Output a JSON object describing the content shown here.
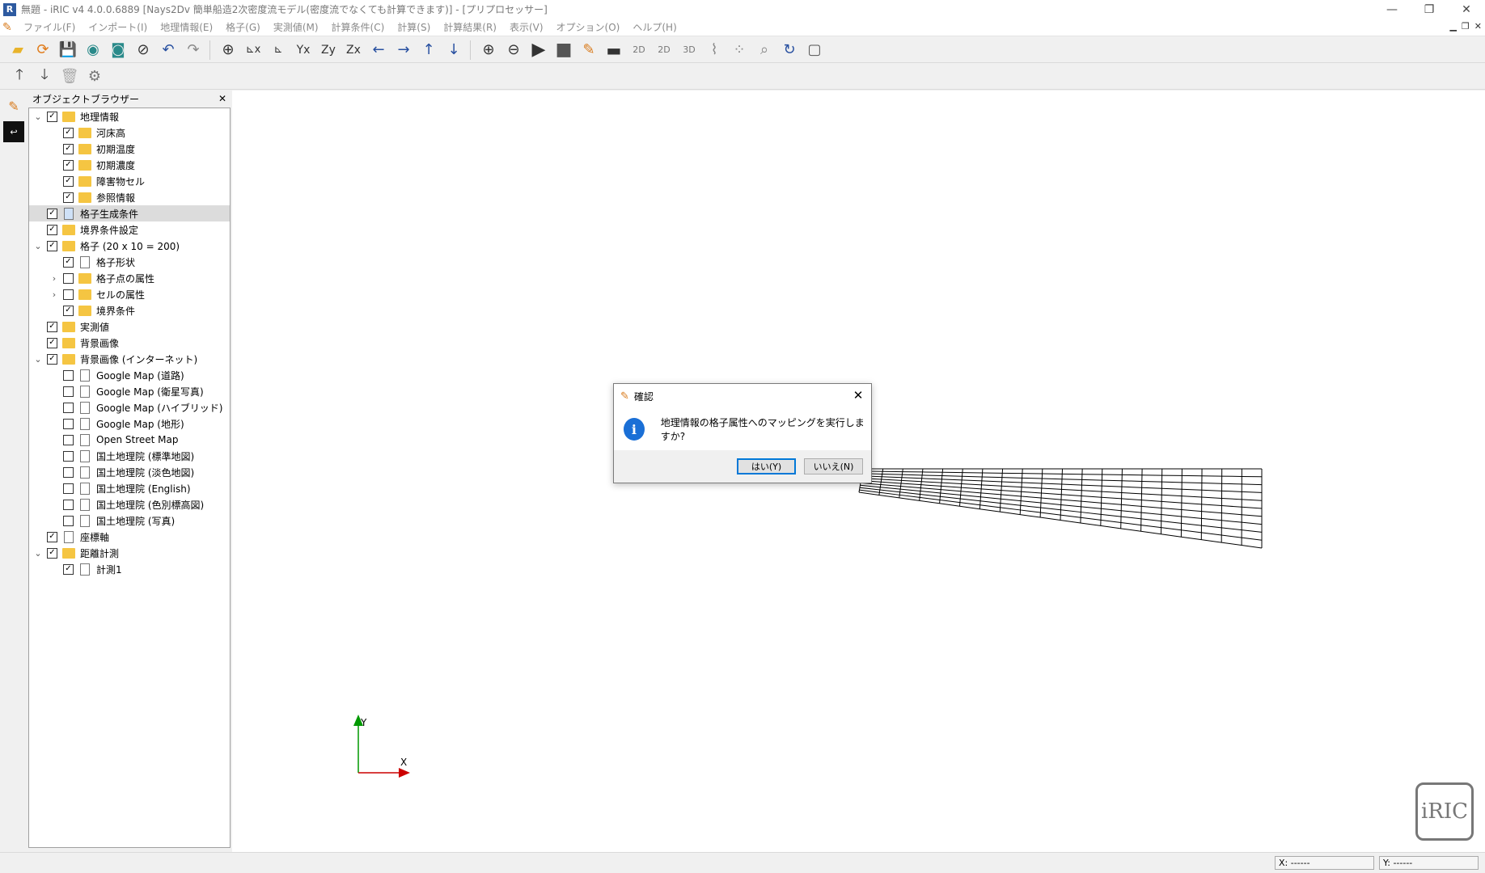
{
  "window": {
    "title": "無題 - iRIC v4 4.0.0.6889 [Nays2Dv 簡単船造2次密度流モデル(密度流でなくても計算できます)] - [プリプロセッサー]",
    "minimize": "—",
    "restore": "❐",
    "close": "✕"
  },
  "menu": {
    "items": [
      "ファイル(F)",
      "インポート(I)",
      "地理情報(E)",
      "格子(G)",
      "実測値(M)",
      "計算条件(C)",
      "計算(S)",
      "計算結果(R)",
      "表示(V)",
      "オプション(O)",
      "ヘルプ(H)"
    ]
  },
  "object_browser": {
    "title": "オブジェクトブラウザー",
    "close": "✕",
    "tree": [
      {
        "level": 0,
        "expander": "v",
        "checked": true,
        "icon": "folder",
        "label": "地理情報"
      },
      {
        "level": 1,
        "expander": "",
        "checked": true,
        "icon": "folder",
        "label": "河床高"
      },
      {
        "level": 1,
        "expander": "",
        "checked": true,
        "icon": "folder",
        "label": "初期温度"
      },
      {
        "level": 1,
        "expander": "",
        "checked": true,
        "icon": "folder",
        "label": "初期濃度"
      },
      {
        "level": 1,
        "expander": "",
        "checked": true,
        "icon": "folder",
        "label": "障害物セル"
      },
      {
        "level": 1,
        "expander": "",
        "checked": true,
        "icon": "folder",
        "label": "参照情報"
      },
      {
        "level": 0,
        "expander": "",
        "checked": true,
        "icon": "file-blue",
        "label": "格子生成条件",
        "selected": true
      },
      {
        "level": 0,
        "expander": "",
        "checked": true,
        "icon": "folder",
        "label": "境界条件設定"
      },
      {
        "level": 0,
        "expander": "v",
        "checked": true,
        "icon": "folder",
        "label": "格子 (20 x 10 = 200)"
      },
      {
        "level": 1,
        "expander": "",
        "checked": true,
        "icon": "file",
        "label": "格子形状"
      },
      {
        "level": 1,
        "expander": ">",
        "checked": false,
        "icon": "folder",
        "label": "格子点の属性"
      },
      {
        "level": 1,
        "expander": ">",
        "checked": false,
        "icon": "folder",
        "label": "セルの属性"
      },
      {
        "level": 1,
        "expander": "",
        "checked": true,
        "icon": "folder",
        "label": "境界条件"
      },
      {
        "level": 0,
        "expander": "",
        "checked": true,
        "icon": "folder",
        "label": "実測値"
      },
      {
        "level": 0,
        "expander": "",
        "checked": true,
        "icon": "folder",
        "label": "背景画像"
      },
      {
        "level": 0,
        "expander": "v",
        "checked": true,
        "icon": "folder",
        "label": "背景画像 (インターネット)"
      },
      {
        "level": 1,
        "expander": "",
        "checked": false,
        "icon": "file",
        "label": "Google Map (道路)"
      },
      {
        "level": 1,
        "expander": "",
        "checked": false,
        "icon": "file",
        "label": "Google Map (衛星写真)"
      },
      {
        "level": 1,
        "expander": "",
        "checked": false,
        "icon": "file",
        "label": "Google Map (ハイブリッド)"
      },
      {
        "level": 1,
        "expander": "",
        "checked": false,
        "icon": "file",
        "label": "Google Map (地形)"
      },
      {
        "level": 1,
        "expander": "",
        "checked": false,
        "icon": "file",
        "label": "Open Street Map"
      },
      {
        "level": 1,
        "expander": "",
        "checked": false,
        "icon": "file",
        "label": "国土地理院 (標準地図)"
      },
      {
        "level": 1,
        "expander": "",
        "checked": false,
        "icon": "file",
        "label": "国土地理院 (淡色地図)"
      },
      {
        "level": 1,
        "expander": "",
        "checked": false,
        "icon": "file",
        "label": "国土地理院 (English)"
      },
      {
        "level": 1,
        "expander": "",
        "checked": false,
        "icon": "file",
        "label": "国土地理院 (色別標高図)"
      },
      {
        "level": 1,
        "expander": "",
        "checked": false,
        "icon": "file",
        "label": "国土地理院 (写真)"
      },
      {
        "level": 0,
        "expander": "",
        "checked": true,
        "icon": "file",
        "label": "座標軸"
      },
      {
        "level": 0,
        "expander": "v",
        "checked": true,
        "icon": "folder",
        "label": "距離計測"
      },
      {
        "level": 1,
        "expander": "",
        "checked": true,
        "icon": "file",
        "label": "計測1"
      }
    ]
  },
  "viewport": {
    "axis_x_label": "X",
    "axis_y_label": "Y",
    "grid": {
      "cols": 20,
      "rows": 10
    },
    "logo": "iRIC"
  },
  "dialog": {
    "title": "確認",
    "message": "地理情報の格子属性へのマッピングを実行しますか?",
    "yes_label": "はい(Y)",
    "no_label": "いいえ(N)",
    "close": "✕"
  },
  "status": {
    "x": "X: ------",
    "y": "Y: ------"
  },
  "colors": {
    "accent": "#0078d7",
    "info_icon": "#1a6fd6",
    "folder": "#f5c542",
    "axis_x": "#cc0000",
    "axis_y": "#009900"
  }
}
